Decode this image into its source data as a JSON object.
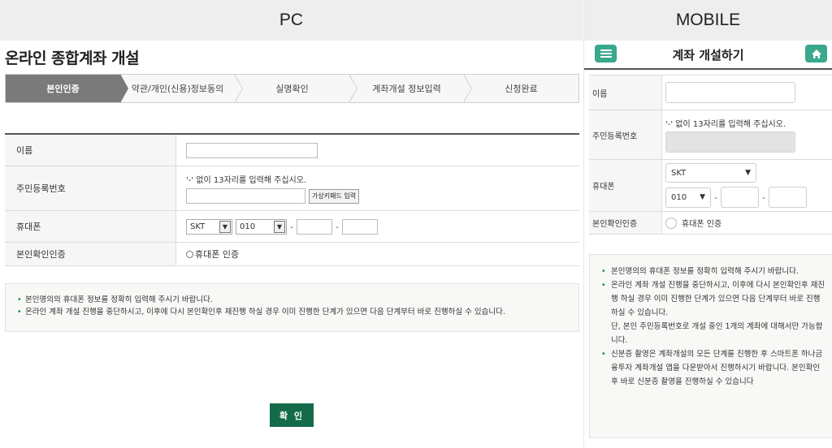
{
  "labels": {
    "pc": "PC",
    "mobile": "MOBILE"
  },
  "pc": {
    "title": "온라인 종합계좌 개설",
    "steps": [
      "본인인증",
      "약관/개인(신용)정보동의",
      "실명확인",
      "계좌개설 정보입력",
      "신청완료"
    ],
    "form": {
      "name_label": "이름",
      "rrn_label": "주민등록번호",
      "rrn_hint": "'-' 없이 13자리를 입력해 주십시오.",
      "keypad_label": "가상키패드 입력",
      "phone_label": "휴대폰",
      "carrier": "SKT",
      "prefix": "010",
      "dash": "-",
      "auth_label": "본인확인인증",
      "auth_option": "휴대폰 인증"
    },
    "notices": [
      "본인명의의 휴대폰 정보를 정확히 입력해 주시기 바랍니다.",
      "온라인 계좌 개설 진행을 중단하시고, 이후에 다시 본인확인후 재진행 하실 경우 이미 진행한 단계가 있으면 다음 단계부터 바로 진행하실 수 있습니다."
    ],
    "confirm_label": "확 인"
  },
  "mobile": {
    "title": "계좌 개설하기",
    "form": {
      "name_label": "이름",
      "rrn_label": "주민등록번호",
      "rrn_hint": "'-' 없이 13자리를 입력해 주십시오.",
      "phone_label": "휴대폰",
      "carrier": "SKT",
      "prefix": "010",
      "dash": "-",
      "auth_label": "본인확인인증",
      "auth_option": "휴대폰 인증"
    },
    "notices": [
      "본인명의의 휴대폰 정보를 정확히 입력해 주시기 바랍니다.",
      "온라인 계좌 개설 진행을 중단하시고, 이후에 다시 본인확인후 재진행 하실 경우 이미 진행한 단계가 있으면 다음 단계부터 바로 진행하실 수 있습니다.",
      "단, 본인 주민등록번호로 개설 중인 1개의 계좌에 대해서만 가능합니다.",
      "신분증 촬영은 계좌개설의 모든 단계를 진행한 후 스마트폰 하나금융투자 계좌개설 앱을 다운받아서 진행하시기 바랍니다. 본인확인후 바로 신분증 촬영을 진행하실 수 있습니다"
    ]
  },
  "colors": {
    "accent": "#146b4a",
    "mobile_button": "#3aa88d",
    "bullet": "#1e8a5a"
  },
  "icons": {
    "menu": "menu-icon",
    "home": "home-icon"
  }
}
